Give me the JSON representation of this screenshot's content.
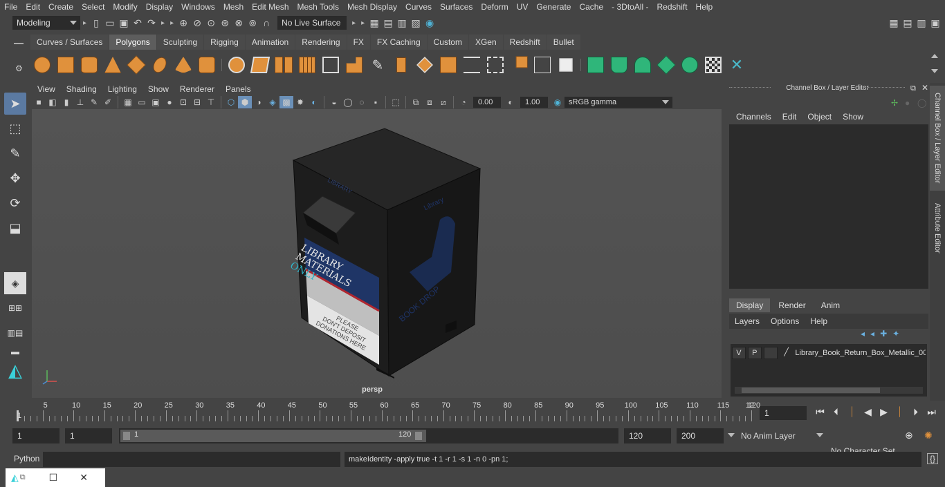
{
  "menubar": [
    "File",
    "Edit",
    "Create",
    "Select",
    "Modify",
    "Display",
    "Windows",
    "Mesh",
    "Edit Mesh",
    "Mesh Tools",
    "Mesh Display",
    "Curves",
    "Surfaces",
    "Deform",
    "UV",
    "Generate",
    "Cache",
    "- 3DtoAll -",
    "Redshift",
    "Help"
  ],
  "status": {
    "mode": "Modeling",
    "live_surface": "No Live Surface"
  },
  "shelf": {
    "tabs": [
      "Curves / Surfaces",
      "Polygons",
      "Sculpting",
      "Rigging",
      "Animation",
      "Rendering",
      "FX",
      "FX Caching",
      "Custom",
      "XGen",
      "Redshift",
      "Bullet"
    ],
    "active_tab": "Polygons"
  },
  "viewport": {
    "menu": [
      "View",
      "Shading",
      "Lighting",
      "Show",
      "Renderer",
      "Panels"
    ],
    "exposure": "0.00",
    "gamma": "1.00",
    "colorspace": "sRGB gamma",
    "camera": "persp",
    "model": {
      "top_label": "LIBRARY",
      "side_label": "Library",
      "sign_lines": [
        "LIBRARY",
        "MATERIALS",
        "ONLY"
      ],
      "notice_lines": [
        "PLEASE",
        "DON'T DEPOSIT",
        "DONATIONS HERE"
      ],
      "book_drop": "BOOK DROP"
    }
  },
  "channelbox": {
    "title": "Channel Box / Layer Editor",
    "menu": [
      "Channels",
      "Edit",
      "Object",
      "Show"
    ],
    "tabs": [
      "Display",
      "Render",
      "Anim"
    ],
    "active_tab": "Display",
    "layer_menu": [
      "Layers",
      "Options",
      "Help"
    ],
    "layer": {
      "v": "V",
      "p": "P",
      "name": "Library_Book_Return_Box_Metallic_00"
    }
  },
  "sidetabs": {
    "channel": "Channel Box / Layer Editor",
    "attribute": "Attribute Editor"
  },
  "timeline": {
    "ticks": [
      5,
      10,
      15,
      20,
      25,
      30,
      35,
      40,
      45,
      50,
      55,
      60,
      65,
      70,
      75,
      80,
      85,
      90,
      95,
      100,
      105,
      110,
      115,
      120
    ],
    "start_label": "1",
    "end_label": "12",
    "current_frame": "1"
  },
  "range": {
    "start": "1",
    "anim_start": "1",
    "slider_start": "1",
    "slider_end": "120",
    "playback_end": "120",
    "anim_end": "200",
    "anim_layer": "No Anim Layer",
    "char_set": "No Character Set"
  },
  "cmdline": {
    "lang": "Python",
    "result": "makeIdentity -apply true -t 1 -r 1 -s 1 -n 0 -pn 1;"
  }
}
